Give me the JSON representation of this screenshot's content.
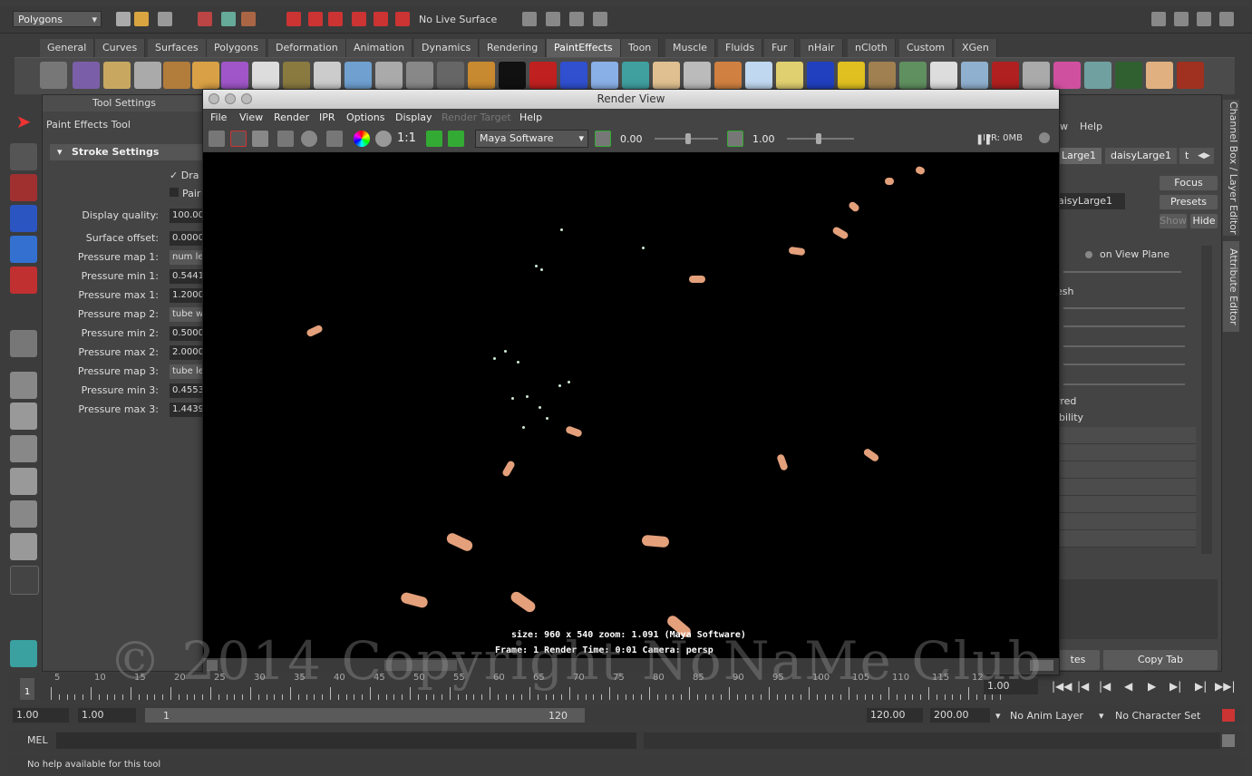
{
  "status_line": {
    "mode": "Polygons",
    "live_surface": "No Live Surface"
  },
  "shelf_tabs": [
    "General",
    "Curves",
    "Surfaces",
    "Polygons",
    "Deformation",
    "Animation",
    "Dynamics",
    "Rendering",
    "PaintEffects",
    "Toon",
    "Muscle",
    "Fluids",
    "Fur",
    "nHair",
    "nCloth",
    "Custom",
    "XGen"
  ],
  "active_shelf_tab": "PaintEffects",
  "tool_settings": {
    "header": "Tool Settings",
    "tool_name": "Paint Effects Tool",
    "section": "Stroke Settings",
    "check1": "Dra",
    "check2": "Pair",
    "props": [
      {
        "label": "Display quality:",
        "value": "100.00"
      },
      {
        "label": "Surface offset:",
        "value": "0.0000"
      },
      {
        "label": "Pressure map 1:",
        "value": "num le"
      },
      {
        "label": "Pressure min 1:",
        "value": "0.5441"
      },
      {
        "label": "Pressure max 1:",
        "value": "1.2000"
      },
      {
        "label": "Pressure map 2:",
        "value": "tube w"
      },
      {
        "label": "Pressure min 2:",
        "value": "0.5000"
      },
      {
        "label": "Pressure max 2:",
        "value": "2.0000"
      },
      {
        "label": "Pressure map 3:",
        "value": "tube le"
      },
      {
        "label": "Pressure min 3:",
        "value": "0.4553"
      },
      {
        "label": "Pressure max 3:",
        "value": "1.4439"
      }
    ]
  },
  "render_view": {
    "title": "Render View",
    "menus": [
      "File",
      "View",
      "Render",
      "IPR",
      "Options",
      "Display",
      "Render Target",
      "Help"
    ],
    "ratio": "1:1",
    "renderer": "Maya Software",
    "exposure": "0.00",
    "gamma": "1.00",
    "ipr": "IPR: 0MB",
    "info_line1": "size: 960 x 540 zoom: 1.091     (Maya Software)",
    "info_line2": "Frame: 1     Render Time: 0:01     Camera: persp"
  },
  "attribute_editor": {
    "menu_help": "Help",
    "menu_w": "w",
    "tabs": [
      "Large1",
      "daisyLarge1",
      "t"
    ],
    "node_field": "aisyLarge1",
    "focus": "Focus",
    "presets": "Presets",
    "show": "Show",
    "hide": "Hide",
    "on_view_plane": "on View Plane",
    "esh": "esh",
    "rred": "rred",
    "ibility": "ibility",
    "tes": "tes",
    "copy_tab": "Copy Tab"
  },
  "side_tabs": [
    "Channel Box / Layer Editor",
    "Attribute Editor"
  ],
  "time_slider": {
    "ticks": [
      "5",
      "10",
      "15",
      "20",
      "25",
      "30",
      "35",
      "40",
      "45",
      "50",
      "55",
      "60",
      "65",
      "70",
      "75",
      "80",
      "85",
      "90",
      "95",
      "100",
      "105",
      "110",
      "115",
      "12"
    ],
    "start_marker": "1",
    "current_frame": "1.00"
  },
  "range": {
    "start": "1.00",
    "playback_start": "1.00",
    "range_start": "1",
    "range_end": "120",
    "playback_end": "120.00",
    "end": "200.00",
    "anim_layer": "No Anim Layer",
    "character_set": "No Character Set"
  },
  "command_line": {
    "label": "MEL"
  },
  "help_line": "No help available for this tool",
  "watermark": "© 2014 Copyright NoNaMe Club",
  "colors": {
    "accent": "#5a5a5a",
    "background": "#3c3c3c",
    "render_bg": "#000000",
    "hand": "#e3a07b"
  }
}
